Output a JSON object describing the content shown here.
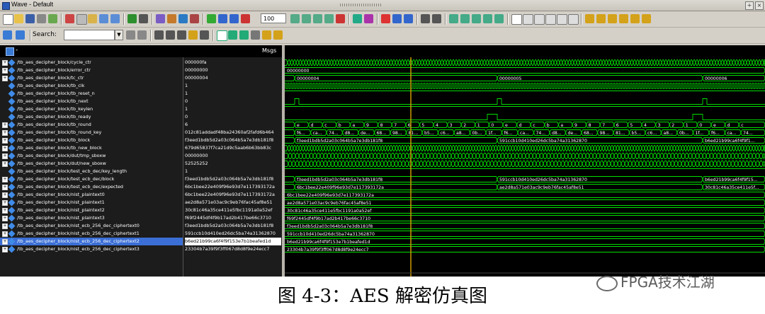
{
  "window": {
    "title": "Wave - Default"
  },
  "toolbar": {
    "zoom_value": "100",
    "search_label": "Search:",
    "search_value": ""
  },
  "pane": {
    "msgs_label": "Msgs"
  },
  "signals": [
    {
      "name": "/tb_aes_decipher_block/cycle_ctr",
      "value": "000000fa",
      "bus": true
    },
    {
      "name": "/tb_aes_decipher_block/error_ctr",
      "value": "00000000",
      "bus": true
    },
    {
      "name": "/tb_aes_decipher_block/tc_ctr",
      "value": "00000004",
      "bus": true
    },
    {
      "name": "/tb_aes_decipher_block/tb_clk",
      "value": "1",
      "bus": false
    },
    {
      "name": "/tb_aes_decipher_block/tb_reset_n",
      "value": "1",
      "bus": false
    },
    {
      "name": "/tb_aes_decipher_block/tb_next",
      "value": "0",
      "bus": false
    },
    {
      "name": "/tb_aes_decipher_block/tb_keylen",
      "value": "1",
      "bus": false
    },
    {
      "name": "/tb_aes_decipher_block/tb_ready",
      "value": "0",
      "bus": false
    },
    {
      "name": "/tb_aes_decipher_block/tb_round",
      "value": "6",
      "bus": true
    },
    {
      "name": "/tb_aes_decipher_block/tb_round_key",
      "value": "012c81addadf48ba24360af2fafd6b464",
      "bus": true
    },
    {
      "name": "/tb_aes_decipher_block/tb_block",
      "value": "f3eed1bdb5d2a03c064b5a7e3db181f8",
      "bus": true
    },
    {
      "name": "/tb_aes_decipher_block/tb_new_block",
      "value": "679d65837f7ca21d9c5aab6b63bb83c",
      "bus": true
    },
    {
      "name": "/tb_aes_decipher_block/dut/tmp_sboxw",
      "value": "00000000",
      "bus": true
    },
    {
      "name": "/tb_aes_decipher_block/dut/new_sboxw",
      "value": "52525252",
      "bus": true
    },
    {
      "name": "/tb_aes_decipher_block/test_ecb_dec/key_length",
      "value": "1",
      "bus": false
    },
    {
      "name": "/tb_aes_decipher_block/test_ecb_dec/block",
      "value": "f3eed1bdb5d2a03c064b5a7e3db181f8",
      "bus": true
    },
    {
      "name": "/tb_aes_decipher_block/test_ecb_dec/expected",
      "value": "6bc1bee22e409f96e93d7e117393172a",
      "bus": true
    },
    {
      "name": "/tb_aes_decipher_block/nist_plaintext0",
      "value": "6bc1bee22e409f96e93d7e117393172a",
      "bus": true
    },
    {
      "name": "/tb_aes_decipher_block/nist_plaintext1",
      "value": "ae2d8a571e03ac9c9eb76fac45af8e51",
      "bus": true
    },
    {
      "name": "/tb_aes_decipher_block/nist_plaintext2",
      "value": "30c81c46a35ce411e5fbc1191a0a52ef",
      "bus": true
    },
    {
      "name": "/tb_aes_decipher_block/nist_plaintext3",
      "value": "f69f2445df4f9b17ad2b417be66c3710",
      "bus": true
    },
    {
      "name": "/tb_aes_decipher_block/nist_ecb_256_dec_ciphertext0",
      "value": "f3eed1bdb5d2a03c064b5a7e3db181f8",
      "bus": true
    },
    {
      "name": "/tb_aes_decipher_block/nist_ecb_256_dec_ciphertext1",
      "value": "591ccb10d410ed26dc5ba74a31362870",
      "bus": true
    },
    {
      "name": "/tb_aes_decipher_block/nist_ecb_256_dec_ciphertext2",
      "value": "b6ed21b99ca6f4f9f153e7b1beafed1d",
      "bus": true,
      "selected": true
    },
    {
      "name": "/tb_aes_decipher_block/nist_ecb_256_dec_ciphertext3",
      "value": "23304b7a39f9f3ff067d8d8f9e24ecc7",
      "bus": true
    }
  ],
  "waves": {
    "error_ctr_label": "00000000",
    "tc_ctr_labels": [
      "00000004",
      "00000005",
      "00000006"
    ],
    "round_labels": [
      "e",
      "d",
      "c",
      "b",
      "a",
      "9",
      "8",
      "7",
      "6",
      "5",
      "4",
      "3",
      "2",
      "1",
      "0",
      "e",
      "d",
      "c",
      "b",
      "a",
      "9",
      "8",
      "7",
      "6",
      "5",
      "4",
      "3",
      "2",
      "1",
      "0",
      "e",
      "d",
      "c"
    ],
    "round_key_labels": [
      "f6...",
      "ca...",
      "74...",
      "d8...",
      "de...",
      "68...",
      "98...",
      "81...",
      "b5...",
      "c6...",
      "a8...",
      "0b...",
      "1f...",
      "f6...",
      "ca...",
      "74...",
      "d8...",
      "de...",
      "68...",
      "98...",
      "81...",
      "b5...",
      "c6...",
      "a8...",
      "0b...",
      "1f...",
      "f6...",
      "ca...",
      "74..."
    ],
    "tb_block_labels": [
      "f3eed1bdb5d2a03c064b5a7e3db181f8",
      "591ccb10d410ed26dc5ba74a31362870",
      "b6ed21b99ca6f4f9f1..."
    ],
    "test_block_labels": [
      "f3eed1bdb5d2a03c064b5a7e3db181f8",
      "591ccb10d410ed26dc5ba74a31362870",
      "b6ed21b99ca6f4f9f15..."
    ],
    "expected_labels": [
      "6bc1bee22e409f96e93d7e117393172a",
      "ae2d8a571e03ac9c9eb76fac45af8e51",
      "30c81c46a35ce411e5f..."
    ],
    "const_labels": {
      "p0": "6bc1bee22e409f96e93d7e117393172a",
      "p1": "ae2d8a571e03ac9c9eb76fac45af8e51",
      "p2": "30c81c46a35ce411e5fbc1191a0a52ef",
      "p3": "f69f2445df4f9b17ad2b417be66c3710",
      "c0": "f3eed1bdb5d2a03c064b5a7e3db181f8",
      "c1": "591ccb10d410ed26dc5ba74a31362870",
      "c2": "b6ed21b99ca6f4f9f153e7b1beafed1d",
      "c3": "23304b7a39f9f3ff067d8d8f9e24ecc7"
    }
  },
  "caption": "图 4-3：AES 解密仿真图",
  "watermark": "FPGA技术江湖",
  "colors": {
    "wave": "#00e000",
    "cursor": "#d9a400",
    "selected": "#3b6fd6"
  }
}
